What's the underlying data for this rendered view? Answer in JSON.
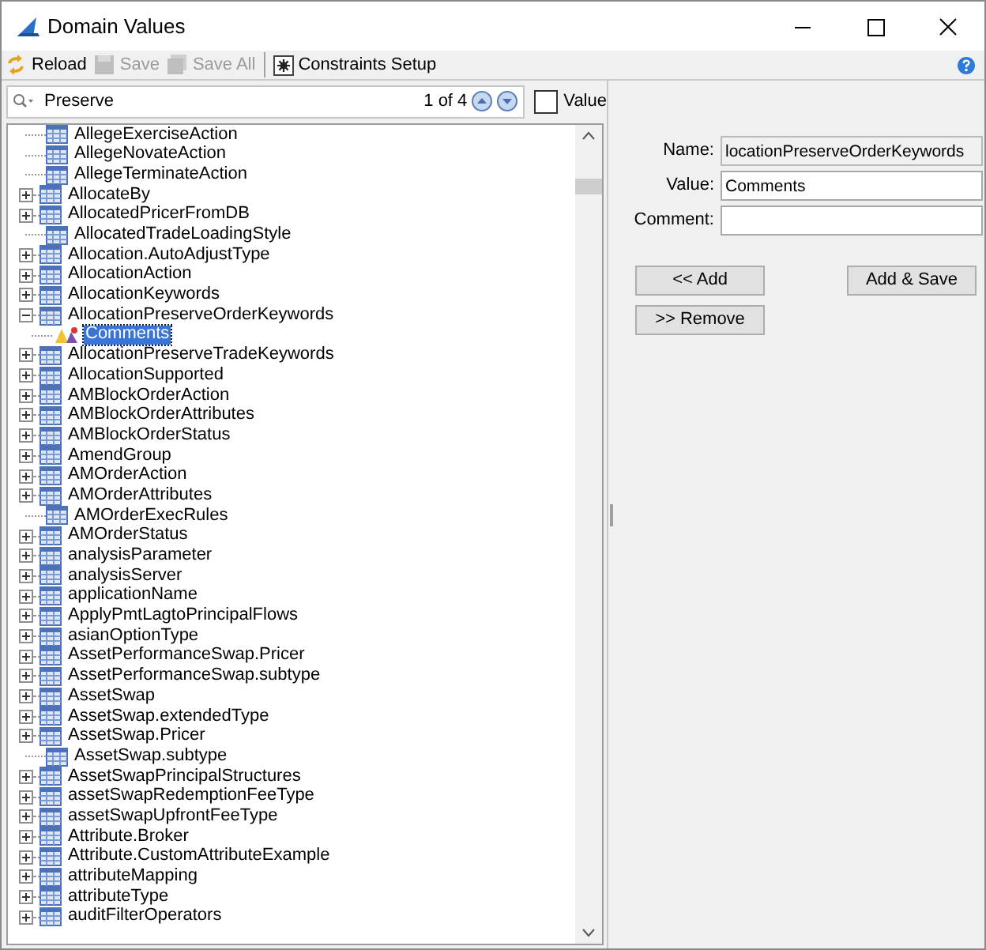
{
  "window": {
    "title": "Domain Values"
  },
  "toolbar": [
    {
      "label": "Reload",
      "disabled": false,
      "kind": "reload"
    },
    {
      "label": "Save",
      "disabled": true,
      "kind": "save"
    },
    {
      "label": "Save All",
      "disabled": true,
      "kind": "saveall"
    },
    {
      "label": "Constraints Setup",
      "disabled": false,
      "kind": "constraints"
    }
  ],
  "search": {
    "value": "Preserve",
    "match_count": "1 of 4"
  },
  "value_checkbox": {
    "label": "Value",
    "checked": false
  },
  "tree": [
    {
      "label": "AllegeExerciseAction",
      "kind": "leaf",
      "selected": false
    },
    {
      "label": "AllegeNovateAction",
      "kind": "leaf",
      "selected": false
    },
    {
      "label": "AllegeTerminateAction",
      "kind": "leaf",
      "selected": false
    },
    {
      "label": "AllocateBy",
      "kind": "group",
      "expanded": false,
      "selected": false
    },
    {
      "label": "AllocatedPricerFromDB",
      "kind": "group",
      "expanded": false,
      "selected": false
    },
    {
      "label": "AllocatedTradeLoadingStyle",
      "kind": "leaf",
      "selected": false
    },
    {
      "label": "Allocation.AutoAdjustType",
      "kind": "group",
      "expanded": false,
      "selected": false
    },
    {
      "label": "AllocationAction",
      "kind": "group",
      "expanded": false,
      "selected": false
    },
    {
      "label": "AllocationKeywords",
      "kind": "group",
      "expanded": false,
      "selected": false
    },
    {
      "label": "AllocationPreserveOrderKeywords",
      "kind": "group",
      "expanded": true,
      "selected": false,
      "children": [
        {
          "label": "Comments",
          "kind": "value",
          "selected": true
        }
      ]
    },
    {
      "label": "AllocationPreserveTradeKeywords",
      "kind": "group",
      "expanded": false,
      "selected": false
    },
    {
      "label": "AllocationSupported",
      "kind": "group",
      "expanded": false,
      "selected": false
    },
    {
      "label": "AMBlockOrderAction",
      "kind": "group",
      "expanded": false,
      "selected": false
    },
    {
      "label": "AMBlockOrderAttributes",
      "kind": "group",
      "expanded": false,
      "selected": false
    },
    {
      "label": "AMBlockOrderStatus",
      "kind": "group",
      "expanded": false,
      "selected": false
    },
    {
      "label": "AmendGroup",
      "kind": "group",
      "expanded": false,
      "selected": false
    },
    {
      "label": "AMOrderAction",
      "kind": "group",
      "expanded": false,
      "selected": false
    },
    {
      "label": "AMOrderAttributes",
      "kind": "group",
      "expanded": false,
      "selected": false
    },
    {
      "label": "AMOrderExecRules",
      "kind": "leaf",
      "selected": false
    },
    {
      "label": "AMOrderStatus",
      "kind": "group",
      "expanded": false,
      "selected": false
    },
    {
      "label": "analysisParameter",
      "kind": "group",
      "expanded": false,
      "selected": false
    },
    {
      "label": "analysisServer",
      "kind": "group",
      "expanded": false,
      "selected": false
    },
    {
      "label": "applicationName",
      "kind": "group",
      "expanded": false,
      "selected": false
    },
    {
      "label": "ApplyPmtLagtoPrincipalFlows",
      "kind": "group",
      "expanded": false,
      "selected": false
    },
    {
      "label": "asianOptionType",
      "kind": "group",
      "expanded": false,
      "selected": false
    },
    {
      "label": "AssetPerformanceSwap.Pricer",
      "kind": "group",
      "expanded": false,
      "selected": false
    },
    {
      "label": "AssetPerformanceSwap.subtype",
      "kind": "group",
      "expanded": false,
      "selected": false
    },
    {
      "label": "AssetSwap",
      "kind": "group",
      "expanded": false,
      "selected": false
    },
    {
      "label": "AssetSwap.extendedType",
      "kind": "group",
      "expanded": false,
      "selected": false
    },
    {
      "label": "AssetSwap.Pricer",
      "kind": "group",
      "expanded": false,
      "selected": false
    },
    {
      "label": "AssetSwap.subtype",
      "kind": "leaf",
      "selected": false
    },
    {
      "label": "AssetSwapPrincipalStructures",
      "kind": "group",
      "expanded": false,
      "selected": false
    },
    {
      "label": "assetSwapRedemptionFeeType",
      "kind": "group",
      "expanded": false,
      "selected": false
    },
    {
      "label": "assetSwapUpfrontFeeType",
      "kind": "group",
      "expanded": false,
      "selected": false
    },
    {
      "label": "Attribute.Broker",
      "kind": "group",
      "expanded": false,
      "selected": false
    },
    {
      "label": "Attribute.CustomAttributeExample",
      "kind": "group",
      "expanded": false,
      "selected": false
    },
    {
      "label": "attributeMapping",
      "kind": "group",
      "expanded": false,
      "selected": false
    },
    {
      "label": "attributeType",
      "kind": "group",
      "expanded": false,
      "selected": false
    },
    {
      "label": "auditFilterOperators",
      "kind": "group",
      "expanded": false,
      "selected": false
    }
  ],
  "form": {
    "fields": [
      {
        "label": "Name:",
        "value": "locationPreserveOrderKeywords",
        "disabled": true
      },
      {
        "label": "Value:",
        "value": "Comments",
        "disabled": false
      },
      {
        "label": "Comment:",
        "disabled": false
      }
    ],
    "buttons": [
      {
        "label": "<< Add"
      },
      {
        "label": "Add & Save"
      },
      {
        "label": ">> Remove"
      }
    ]
  }
}
